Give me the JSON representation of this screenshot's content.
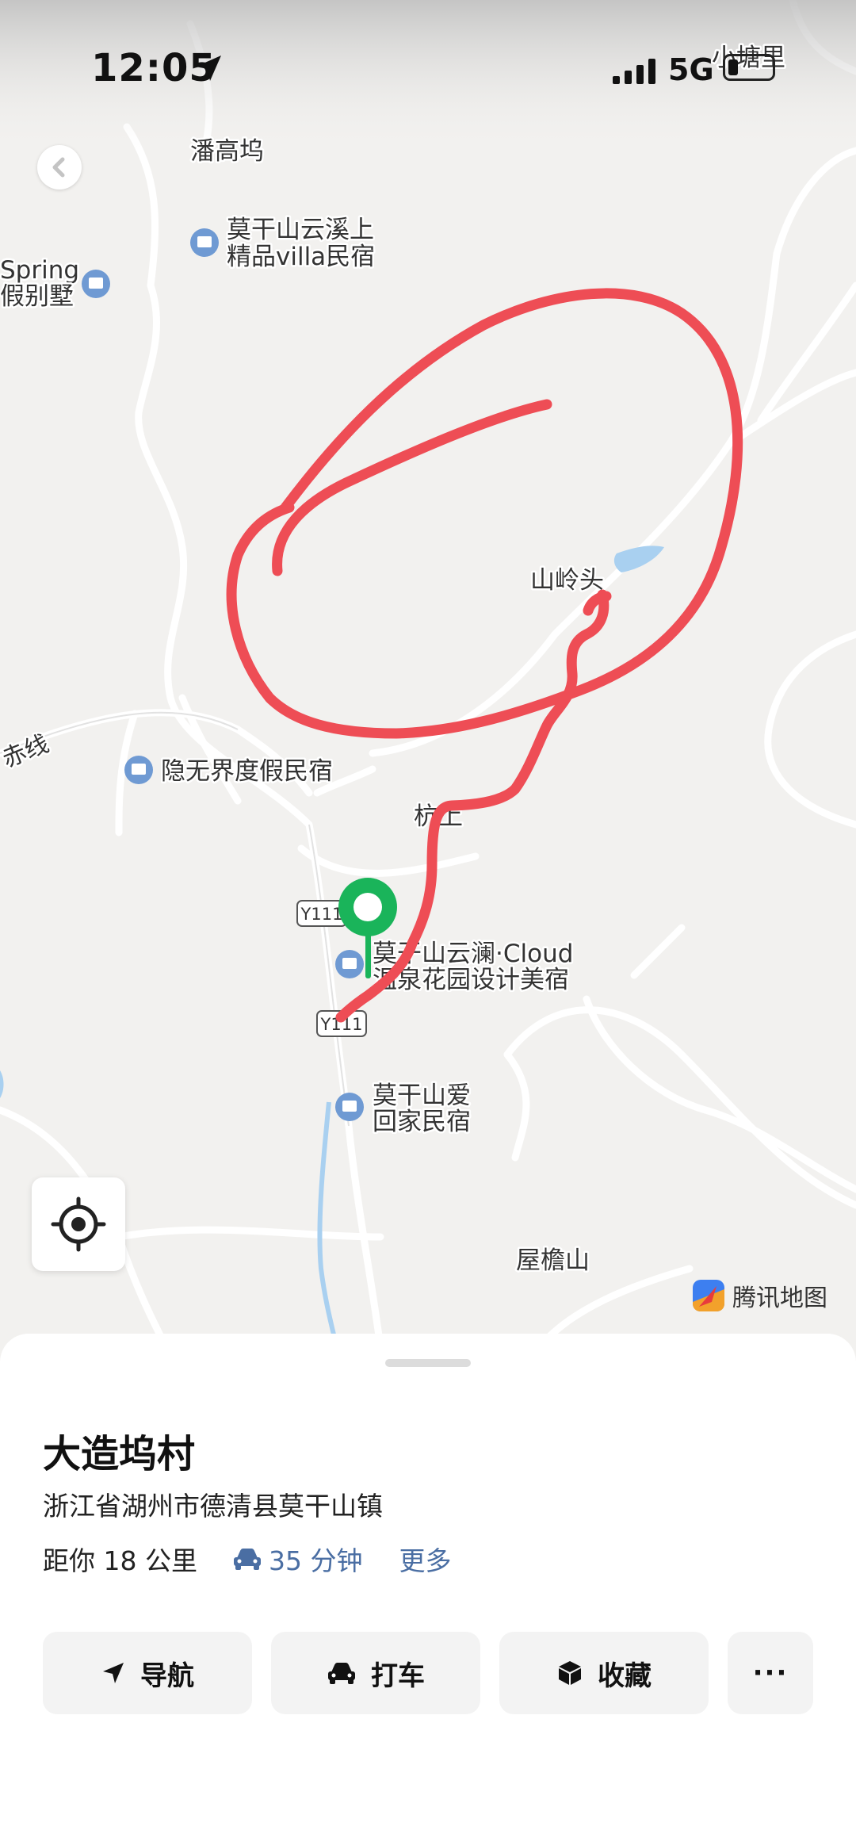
{
  "status_bar": {
    "time": "12:05",
    "network": "5G"
  },
  "map": {
    "labels": {
      "pangaowu": "潘高坞",
      "xiaotangli": "小塘里",
      "spring_top": "Spring",
      "spring_bottom": "假别墅",
      "yunxishang_1": "莫干山云溪上",
      "yunxishang_2": "精品villa民宿",
      "shanlingtou": "山岭头",
      "chixian": "赤线",
      "yinwujie": "隐无界度假民宿",
      "hangshang": "杭上",
      "road_y111_a": "Y111",
      "road_y111_b": "Y111",
      "yunlan_1": "莫干山云澜·Cloud",
      "yunlan_2": "温泉花园设计美宿",
      "aihuijia_1": "莫干山爱",
      "aihuijia_2": "回家民宿",
      "wuyanshan": "屋檐山"
    },
    "brand": "腾讯地图",
    "colors": {
      "annotation": "#ee4d55",
      "pin": "#1ab45a",
      "poi": "#6f9ad3",
      "water": "#a9d0f0"
    }
  },
  "place": {
    "name": "大造坞村",
    "address": "浙江省湖州市德清县莫干山镇",
    "distance": "距你 18 公里",
    "duration": "35 分钟",
    "more": "更多"
  },
  "actions": {
    "navigate": "导航",
    "taxi": "打车",
    "favorite": "收藏",
    "more": "···"
  }
}
